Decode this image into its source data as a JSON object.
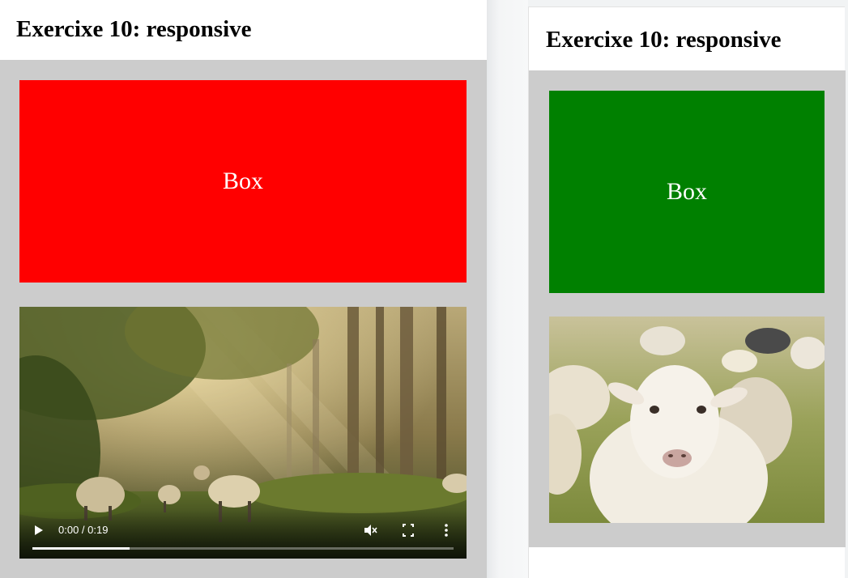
{
  "left": {
    "title": "Exercixe 10: responsive",
    "box_label": "Box",
    "box_color": "#ff0000",
    "video": {
      "time": "0:00 / 0:19",
      "progress": 0.23
    }
  },
  "right": {
    "title": "Exercixe 10: responsive",
    "box_label": "Box",
    "box_color": "#008000"
  },
  "icons": [
    "play-icon",
    "mute-icon",
    "fullscreen-icon",
    "more-vert-icon"
  ]
}
